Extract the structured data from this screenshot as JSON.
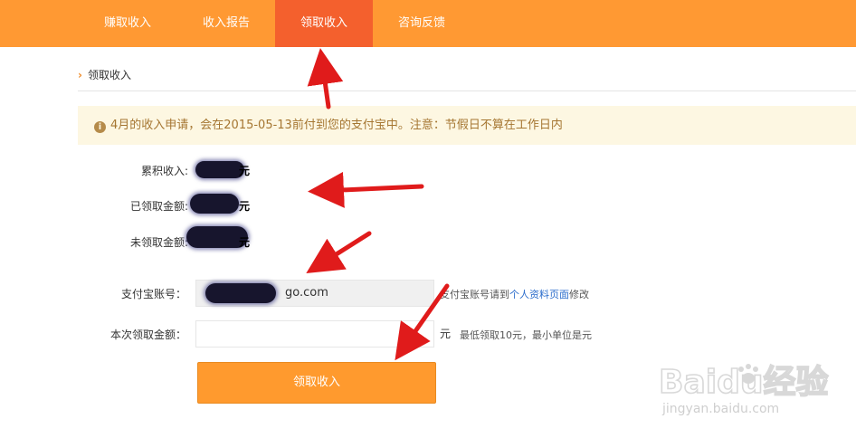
{
  "nav": {
    "tabs": [
      {
        "label": "赚取收入",
        "active": false
      },
      {
        "label": "收入报告",
        "active": false
      },
      {
        "label": "领取收入",
        "active": true
      },
      {
        "label": "咨询反馈",
        "active": false
      }
    ]
  },
  "breadcrumb": {
    "label": "领取收入"
  },
  "notice": {
    "text": "4月的收入申请，会在2015-05-13前付到您的支付宝中。注意：节假日不算在工作日内"
  },
  "summary": {
    "total_label": "累积收入:",
    "total_suffix": "元",
    "received_label": "已领取金额:",
    "received_suffix": "元",
    "pending_label": "未领取金额:",
    "pending_suffix": "元"
  },
  "form": {
    "alipay_label": "支付宝账号：",
    "alipay_value": "go.com",
    "alipay_hint_prefix": "支付宝账号请到",
    "alipay_hint_link": "个人资料页面",
    "alipay_hint_suffix": "修改",
    "amount_label": "本次领取金额：",
    "amount_value": "",
    "amount_unit": "元",
    "amount_hint": "最低领取10元，最小单位是元",
    "submit_label": "领取收入"
  },
  "watermark": {
    "brand": "Baidu经验",
    "url": "jingyan.baidu.com"
  },
  "colors": {
    "nav_bg": "#ff9933",
    "nav_active": "#f4602d",
    "notice_bg": "#fdf7e2",
    "notice_text": "#a57631",
    "button_bg": "#ff9a2e",
    "link": "#2d6ecc",
    "annotation_arrow": "#e01b1b"
  }
}
